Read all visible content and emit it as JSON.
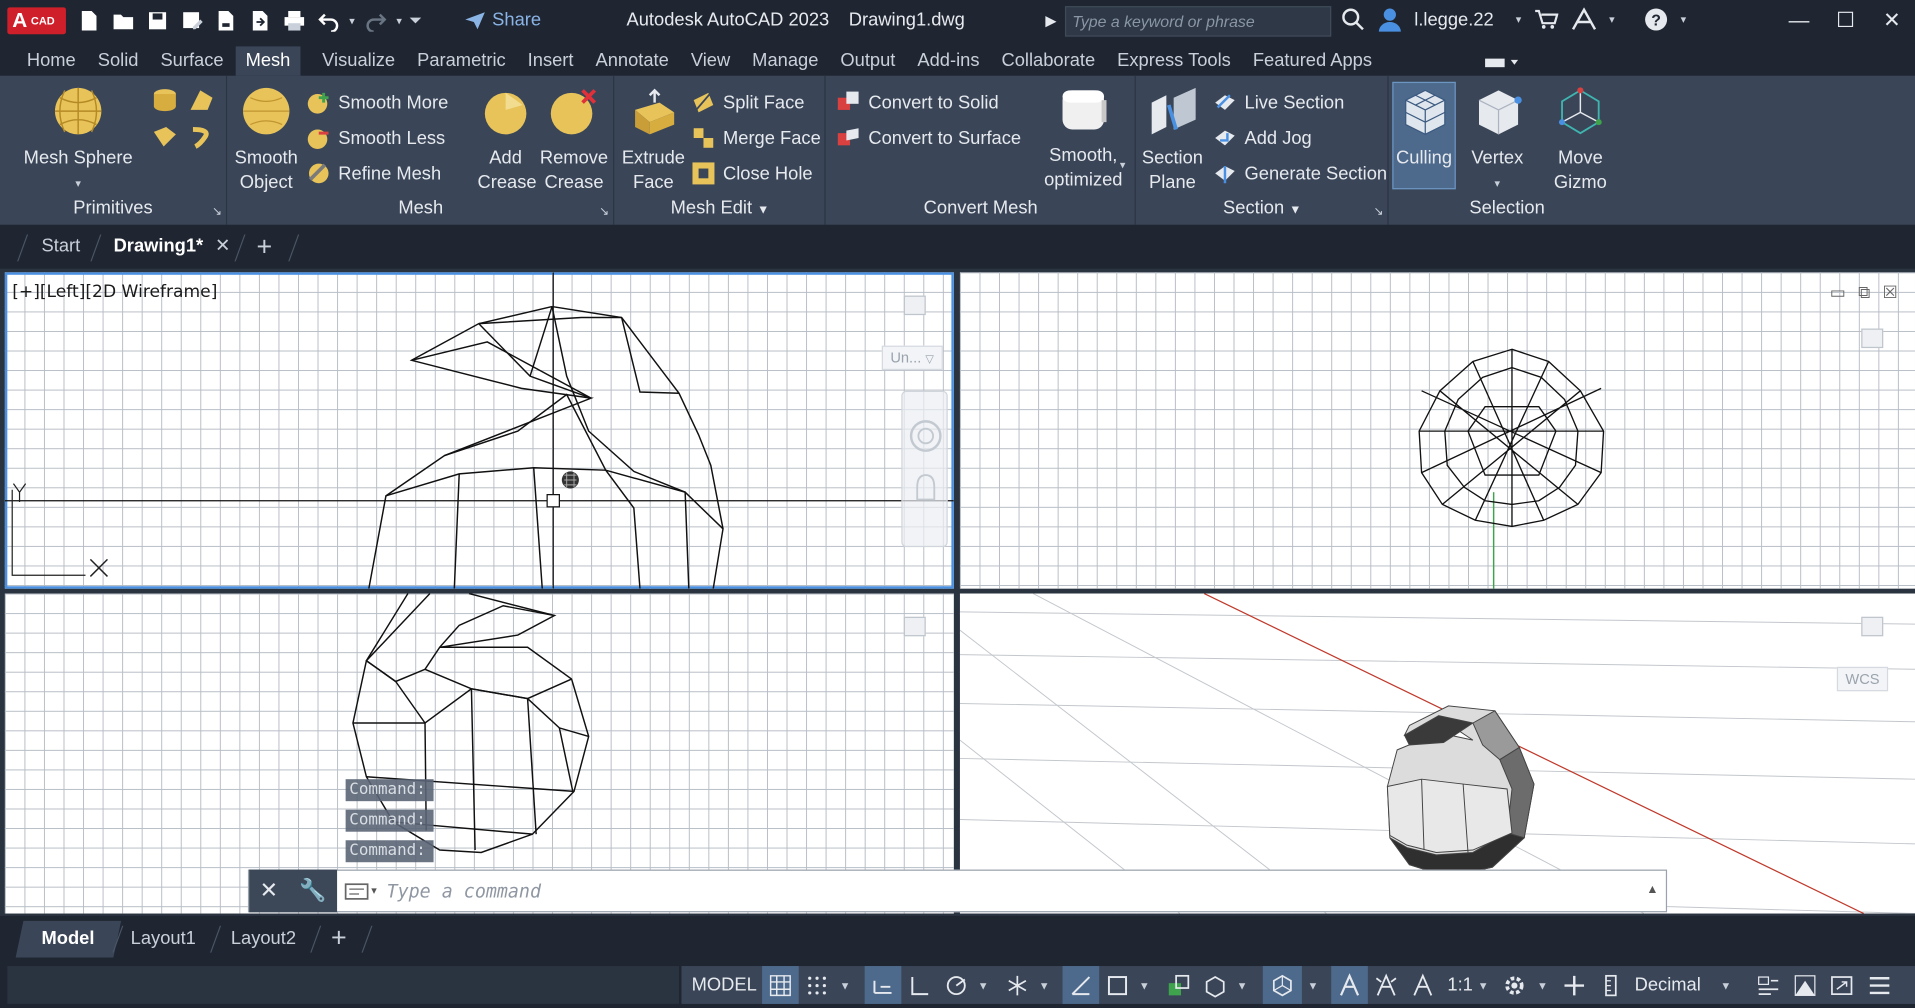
{
  "app": {
    "logo_letter": "A",
    "logo_text": "CAD",
    "title": "Autodesk AutoCAD 2023",
    "filename": "Drawing1.dwg",
    "share_label": "Share",
    "search_placeholder": "Type a keyword or phrase",
    "user_name": "l.legge.22"
  },
  "ribbon_tabs": [
    "Home",
    "Solid",
    "Surface",
    "Mesh",
    "Visualize",
    "Parametric",
    "Insert",
    "Annotate",
    "View",
    "Manage",
    "Output",
    "Add-ins",
    "Collaborate",
    "Express Tools",
    "Featured Apps"
  ],
  "active_ribbon_tab": "Mesh",
  "ribbon": {
    "primitives": {
      "title": "Primitives",
      "mesh_sphere": "Mesh Sphere"
    },
    "mesh": {
      "title": "Mesh",
      "smooth_object_1": "Smooth",
      "smooth_object_2": "Object",
      "smooth_more": "Smooth More",
      "smooth_less": "Smooth Less",
      "refine_mesh": "Refine Mesh",
      "add_crease_1": "Add",
      "add_crease_2": "Crease",
      "remove_crease_1": "Remove",
      "remove_crease_2": "Crease"
    },
    "mesh_edit": {
      "title": "Mesh Edit",
      "extrude_face_1": "Extrude",
      "extrude_face_2": "Face",
      "split_face": "Split Face",
      "merge_face": "Merge Face",
      "close_hole": "Close Hole"
    },
    "convert_mesh": {
      "title": "Convert Mesh",
      "convert_to_solid": "Convert to Solid",
      "convert_to_surface": "Convert to Surface",
      "smooth_optimized_1": "Smooth,",
      "smooth_optimized_2": "optimized"
    },
    "section": {
      "title": "Section",
      "section_plane_1": "Section",
      "section_plane_2": "Plane",
      "live_section": "Live Section",
      "add_jog": "Add Jog",
      "generate_section": "Generate Section"
    },
    "selection": {
      "title": "Selection",
      "culling": "Culling",
      "vertex": "Vertex",
      "move_gizmo_1": "Move",
      "move_gizmo_2": "Gizmo"
    }
  },
  "doc_tabs": {
    "start": "Start",
    "drawing": "Drawing1*"
  },
  "viewports": {
    "top_left_label": "[+][Left][2D Wireframe]",
    "unnamed_ucs": "Un...",
    "wcs": "WCS",
    "axis_y": "Y",
    "axis_x": "X"
  },
  "command": {
    "history": [
      "Command:",
      "Command:",
      "Command:"
    ],
    "placeholder": "Type a command"
  },
  "layout_tabs": {
    "model": "Model",
    "layout1": "Layout1",
    "layout2": "Layout2"
  },
  "status": {
    "model": "MODEL",
    "scale": "1:1",
    "units": "Decimal"
  },
  "colors": {
    "accent": "#4a90e2",
    "ribbon_bg": "#3a4658",
    "title_bg": "#1f2631",
    "logo_red": "#cf1f2b"
  }
}
